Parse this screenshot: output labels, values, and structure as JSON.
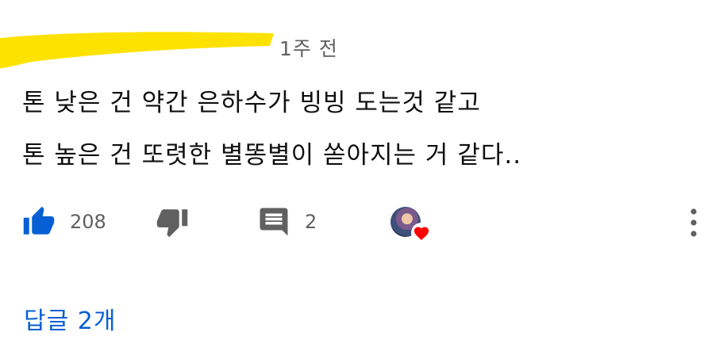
{
  "comment": {
    "timestamp": "1주 전",
    "lines": [
      "톤 낮은 건 약간 은하수가 빙빙 도는것 같고",
      "톤 높은 건 또렷한 별똥별이 쏟아지는 거 같다.."
    ]
  },
  "actions": {
    "like_count": "208",
    "reply_count": "2",
    "like_icon": "thumbs-up-icon",
    "dislike_icon": "thumbs-down-icon",
    "reply_icon": "comment-icon",
    "creator_heart_icon": "heart-icon",
    "more_icon": "more-vertical-icon"
  },
  "replies_link": "답글 2개",
  "colors": {
    "like_blue": "#065fd4",
    "highlight_yellow": "#fde200",
    "icon_gray": "#606060",
    "heart_red": "#ff0000"
  }
}
